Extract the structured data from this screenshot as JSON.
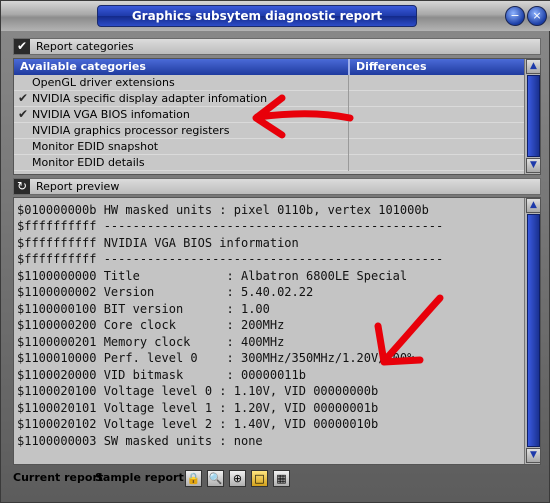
{
  "window": {
    "title": "Graphics subsytem diagnostic report",
    "minimize_icon": "minimize-icon",
    "close_icon": "close-icon"
  },
  "categories_section": {
    "label": "Report categories",
    "icon": "checkmark-icon",
    "column_available": "Available categories",
    "column_differences": "Differences",
    "rows": [
      {
        "label": "OpenGL driver extensions",
        "checked": false
      },
      {
        "label": "NVIDIA specific display adapter infomation",
        "checked": true
      },
      {
        "label": "NVIDIA VGA BIOS infomation",
        "checked": true
      },
      {
        "label": "NVIDIA graphics processor registers",
        "checked": false
      },
      {
        "label": "Monitor EDID snapshot",
        "checked": false
      },
      {
        "label": "Monitor EDID details",
        "checked": false
      }
    ]
  },
  "preview_section": {
    "label": "Report preview",
    "icon": "refresh-icon",
    "lines": [
      "$010000000b HW masked units : pixel 0110b, vertex 101000b",
      "$ffffffffff -----------------------------------------------",
      "$ffffffffff NVIDIA VGA BIOS information",
      "$ffffffffff -----------------------------------------------",
      "$1100000000 Title            : Albatron 6800LE Special",
      "$1100000002 Version          : 5.40.02.22",
      "$1100000100 BIT version      : 1.00",
      "$1100000200 Core clock       : 200MHz",
      "$1100000201 Memory clock     : 400MHz",
      "$1100010000 Perf. level 0    : 300MHz/350MHz/1.20V/100%",
      "$1100020000 VID bitmask      : 00000011b",
      "$1100020100 Voltage level 0 : 1.10V, VID 00000000b",
      "$1100020101 Voltage level 1 : 1.20V, VID 00000001b",
      "$1100020102 Voltage level 2 : 1.40V, VID 00000010b",
      "$1100000003 SW masked units : none"
    ]
  },
  "bottom_tabs": {
    "current_report": "Current report",
    "sample_report": "Sample report",
    "tools": [
      "lock-icon",
      "search-icon",
      "search-plus-icon",
      "folder-open-icon",
      "save-icon"
    ]
  },
  "annotation_color": "#e8000a"
}
